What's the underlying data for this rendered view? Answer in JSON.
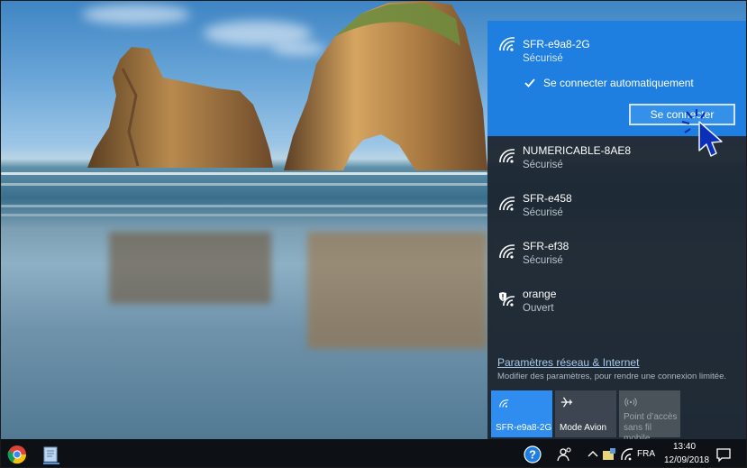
{
  "flyout": {
    "selected_network": {
      "name": "SFR-e9a8-2G",
      "status": "Sécurisé",
      "auto_connect_label": "Se connecter automatiquement",
      "auto_connect_checked": true,
      "connect_button_label": "Se connecter"
    },
    "networks": [
      {
        "name": "NUMERICABLE-8AE8",
        "status": "Sécurisé"
      },
      {
        "name": "SFR-e458",
        "status": "Sécurisé"
      },
      {
        "name": "SFR-ef38",
        "status": "Sécurisé"
      },
      {
        "name": "orange",
        "status": "Ouvert"
      }
    ],
    "settings_link": "Paramètres réseau & Internet",
    "settings_description": "Modifier des paramètres, pour rendre une connexion limitée.",
    "tiles": {
      "wifi_label": "SFR-e9a8-2G",
      "airplane_label": "Mode Avion",
      "hotspot_label_line1": "Point d’accès",
      "hotspot_label_line2": "sans fil mobile"
    }
  },
  "taskbar": {
    "language": "FRA",
    "time": "13:40",
    "date": "12/09/2018"
  },
  "colors": {
    "accent": "#1f7fe0",
    "flyout_bg": "#1c2630",
    "taskbar_bg": "#0d1014"
  }
}
